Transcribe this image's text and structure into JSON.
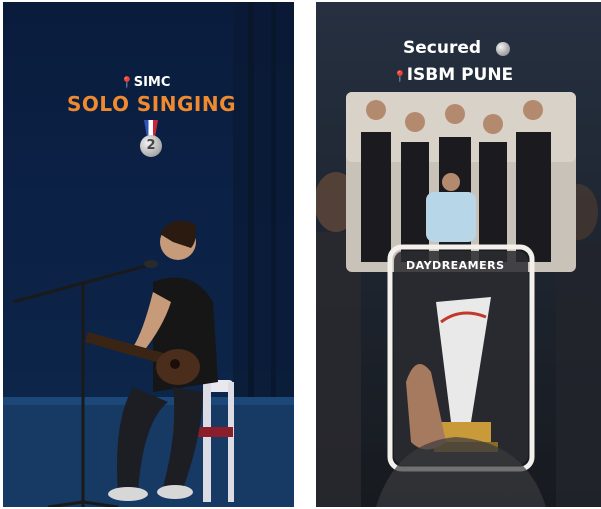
{
  "left_panel": {
    "venue_label": "SIMC",
    "event_title": "SOLO SINGING",
    "medal_text": "2"
  },
  "right_panel": {
    "secured_label": "Secured",
    "venue_label": "ISBM PUNE",
    "team_name": "DAYDREAMERS"
  },
  "colors": {
    "event_title": "#f08a2f",
    "pin": "#e0302a",
    "stage_blue": "#0b2146"
  },
  "icons": [
    "pin-icon",
    "silver-medal-icon"
  ]
}
